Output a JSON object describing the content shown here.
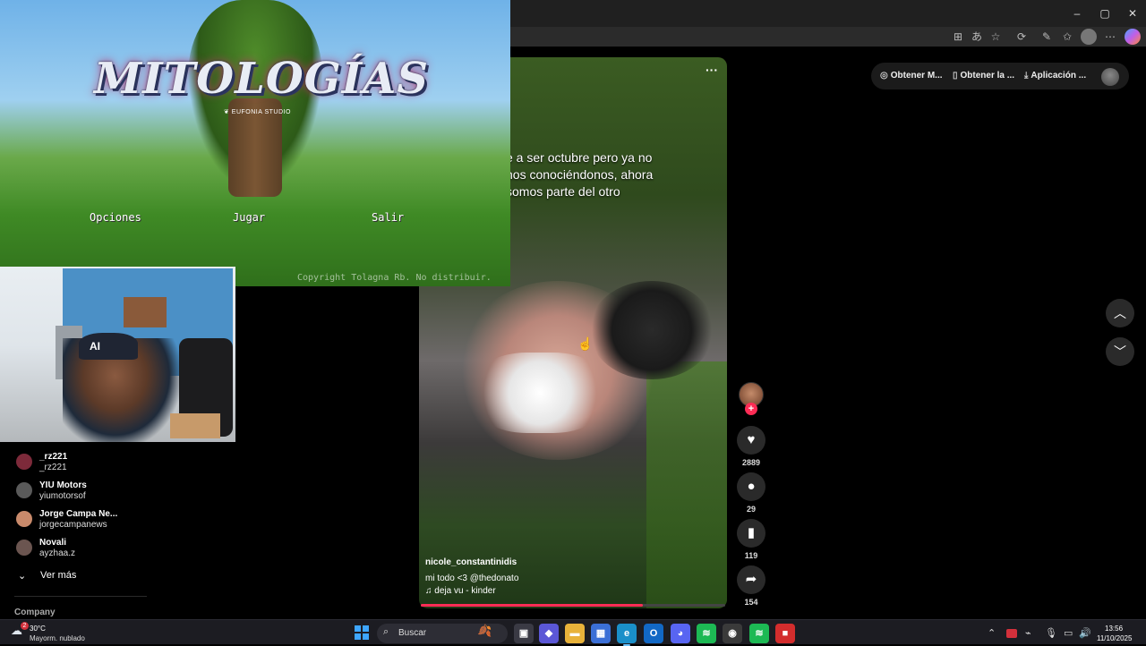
{
  "window": {
    "minimize": "–",
    "maximize": "▢",
    "close": "✕"
  },
  "toolbar_icons": [
    "grid-icon",
    "translate-icon",
    "star-icon",
    "puzzle-icon",
    "extensions-icon",
    "favorites-icon",
    "profile-icon",
    "more-icon",
    "copilot-icon"
  ],
  "topbar": {
    "get_m": "Obtener M...",
    "get_app": "Obtener la ...",
    "app": "Aplicación ..."
  },
  "video": {
    "more": "···",
    "caption": "e a ser octubre pero ya no\nnos conociéndonos, ahora\nsomos parte del otro",
    "author": "nicole_constantinidis",
    "description": "mi todo <3 @thedonato",
    "song": "♫ deja vu - kinder",
    "progress": 0.73
  },
  "actions": {
    "likes": "2889",
    "comments": "29",
    "saves": "119",
    "shares": "154"
  },
  "game": {
    "title": "MITOLOGÍAS",
    "studio": "❦ EUFONIA STUDIO",
    "menu": [
      "Opciones",
      "Jugar",
      "Salir"
    ],
    "copyright": "Copyright Tolagna Rb. No distribuir."
  },
  "webcam": {
    "cap_logo": "AI"
  },
  "accounts": [
    {
      "name": "_rz221",
      "handle": "_rz221",
      "color": "#7d2a3a"
    },
    {
      "name": "YIU Motors",
      "handle": "yiumotorsof",
      "color": "#5a5a5a"
    },
    {
      "name": "Jorge Campa Ne...",
      "handle": "jorgecampanews",
      "color": "#c98a6b"
    },
    {
      "name": "Novali",
      "handle": "ayzhaa.z",
      "color": "#6b5550"
    }
  ],
  "more_label": "Ver más",
  "company_label": "Company",
  "taskbar": {
    "weather_badge": "2",
    "temp": "30°C",
    "condition": "Mayorm. nublado",
    "search_placeholder": "Buscar",
    "clock_time": "13:56",
    "clock_date": "11/10/2025",
    "apps": [
      {
        "name": "task-view",
        "glyph": "▣",
        "bg": "#3a3a44"
      },
      {
        "name": "copilot",
        "glyph": "◆",
        "bg": "#5b57d6"
      },
      {
        "name": "file-explorer",
        "glyph": "▬",
        "bg": "#e8b23a"
      },
      {
        "name": "microsoft-store",
        "glyph": "▦",
        "bg": "#3b6fd6"
      },
      {
        "name": "edge",
        "glyph": "e",
        "bg": "#1a8fc9"
      },
      {
        "name": "outlook",
        "glyph": "O",
        "bg": "#1268c5"
      },
      {
        "name": "discord",
        "glyph": "◕",
        "bg": "#5865f2"
      },
      {
        "name": "spotify",
        "glyph": "≋",
        "bg": "#1db954"
      },
      {
        "name": "obs",
        "glyph": "◉",
        "bg": "#3a3a3a"
      },
      {
        "name": "spotify-2",
        "glyph": "≋",
        "bg": "#1db954"
      },
      {
        "name": "app-red",
        "glyph": "■",
        "bg": "#d32d2d"
      }
    ]
  }
}
